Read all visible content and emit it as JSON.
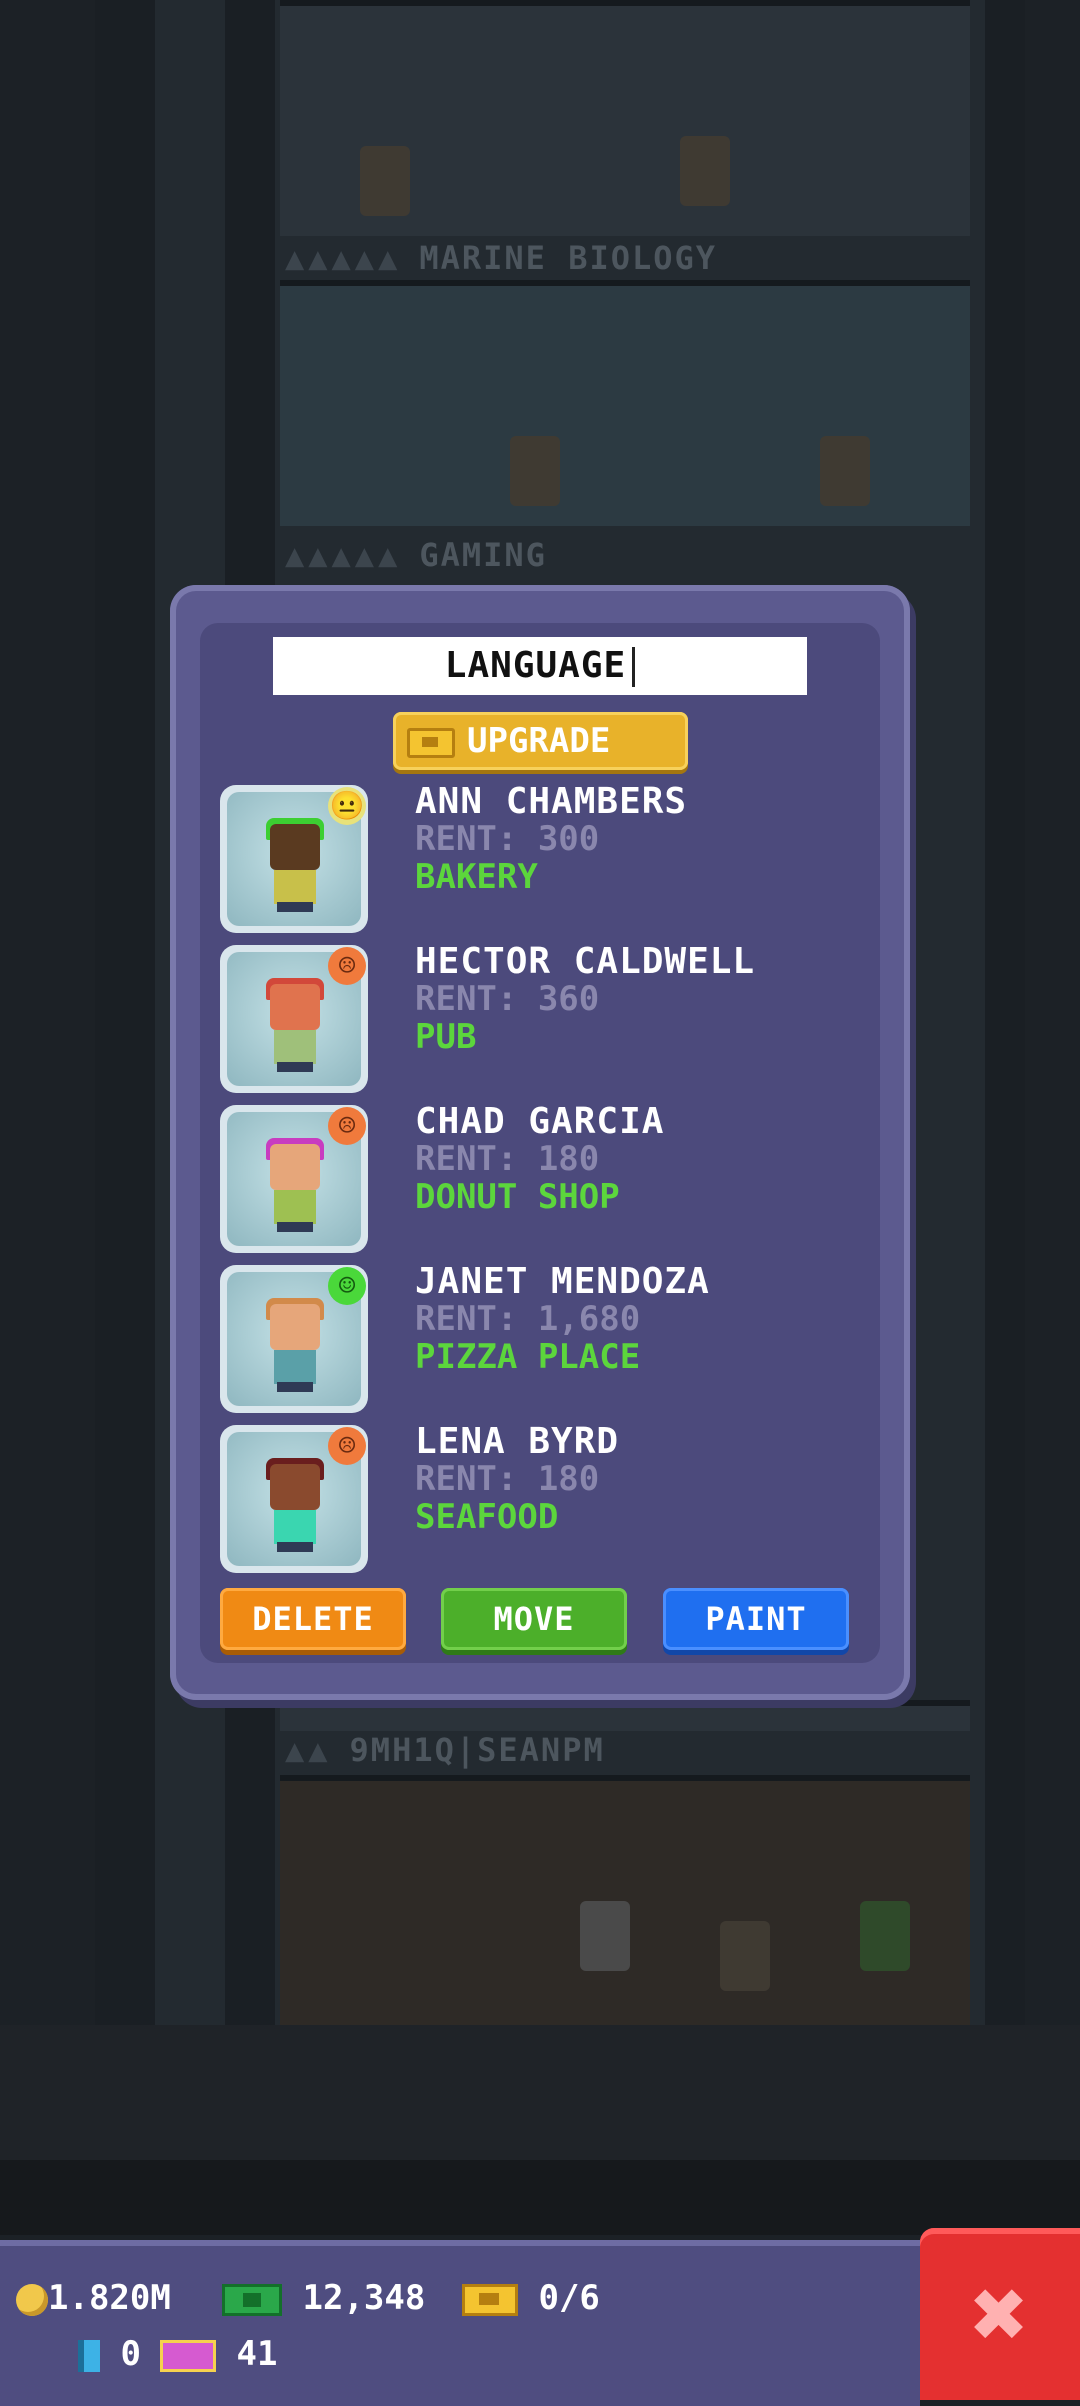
{
  "background": {
    "floors": [
      {
        "label": "MARINE BIOLOGY"
      },
      {
        "label": "GAMING"
      },
      {
        "label": "9MH1Q|SEANPM"
      }
    ]
  },
  "dialog": {
    "floor_name": "LANGUAGE",
    "upgrade_label": "UPGRADE",
    "tenants": [
      {
        "name": "ANN CHAMBERS",
        "rent": "RENT: 300",
        "business": "BAKERY",
        "mood": "neutral",
        "mood_color": "#e8e27a",
        "mood_glyph": "😐",
        "skin": "#5a3a20",
        "hair": "#3ccf32",
        "shirt": "#c8c04a"
      },
      {
        "name": "HECTOR CALDWELL",
        "rent": "RENT: 360",
        "business": "PUB",
        "mood": "unhappy",
        "mood_color": "#f07a3c",
        "mood_glyph": "☹",
        "skin": "#e0734e",
        "hair": "#d2483a",
        "shirt": "#9fc07a"
      },
      {
        "name": "CHAD GARCIA",
        "rent": "RENT: 180",
        "business": "DONUT SHOP",
        "mood": "unhappy",
        "mood_color": "#f07a3c",
        "mood_glyph": "☹",
        "skin": "#e6a67a",
        "hair": "#c83cc0",
        "shirt": "#9ec052"
      },
      {
        "name": "JANET MENDOZA",
        "rent": "RENT: 1,680",
        "business": "PIZZA PLACE",
        "mood": "happy",
        "mood_color": "#4ad83a",
        "mood_glyph": "☺",
        "skin": "#e6a67a",
        "hair": "#d28a4a",
        "shirt": "#5aa0a8"
      },
      {
        "name": "LENA BYRD",
        "rent": "RENT: 180",
        "business": "SEAFOOD",
        "mood": "unhappy",
        "mood_color": "#f07a3c",
        "mood_glyph": "☹",
        "skin": "#8a4a2e",
        "hair": "#6a1e1e",
        "shirt": "#3ad6b0"
      }
    ],
    "buttons": {
      "delete": "DELETE",
      "move": "MOVE",
      "paint": "PAINT"
    }
  },
  "hud": {
    "coins": "1.820M",
    "cash": "12,348",
    "bux_progress": "0/6",
    "elevator_count": "0",
    "vip_count": "41"
  },
  "icons": {
    "coin": "coin-icon",
    "cash": "cash-icon",
    "bux": "tower-bux-icon",
    "close": "close-icon"
  }
}
